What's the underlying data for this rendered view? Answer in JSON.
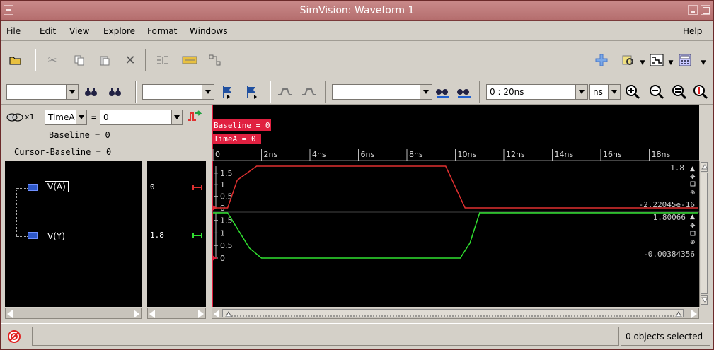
{
  "window": {
    "title": "SimVision: Waveform 1"
  },
  "menu": {
    "file": "File",
    "edit": "Edit",
    "view": "View",
    "explore": "Explore",
    "format": "Format",
    "windows": "Windows",
    "help": "Help"
  },
  "toolbar2": {
    "search_value": "",
    "signal_combo_value": "",
    "cursor_combo_value": "",
    "time_range": "0 : 20ns",
    "time_unit": "ns"
  },
  "cursor_header": {
    "cursor_name": "TimeA",
    "equals": "=",
    "cursor_value": "0",
    "zoom_label": "x1",
    "baseline_text": "Baseline = 0",
    "cursor_baseline_text": "Cursor-Baseline = 0"
  },
  "timeline": {
    "baseline_marker": "Baseline = 0",
    "timea_marker": "TimeA = 0",
    "ticks": [
      "0",
      "2ns",
      "4ns",
      "6ns",
      "8ns",
      "10ns",
      "12ns",
      "14ns",
      "16ns",
      "18ns"
    ]
  },
  "signals": [
    {
      "name": "V(A)",
      "value": "0",
      "color": "#e03030"
    },
    {
      "name": "V(Y)",
      "value": "1.8",
      "color": "#30e030"
    }
  ],
  "waveform_labels": {
    "a_ticks": [
      "1.5",
      "1",
      "0.5",
      "0"
    ],
    "y_ticks": [
      "1.5",
      "1",
      "0.5",
      "0"
    ],
    "a_max": "1.8",
    "a_min": "-2.22045e-16",
    "y_max": "1.80066",
    "y_min": "-0.00384356"
  },
  "chart_data": [
    {
      "type": "line",
      "series": [
        {
          "name": "V(A)",
          "x": [
            0,
            0.6,
            1.0,
            1.8,
            9.6,
            10.4,
            20
          ],
          "values": [
            0,
            0,
            1.2,
            1.8,
            1.8,
            0,
            0
          ]
        }
      ],
      "xlim": [
        0,
        20
      ],
      "ylim": [
        0,
        1.8
      ]
    },
    {
      "type": "line",
      "series": [
        {
          "name": "V(Y)",
          "x": [
            0,
            0.6,
            1.5,
            2.0,
            10.2,
            10.6,
            11.0,
            20
          ],
          "values": [
            1.8,
            1.8,
            0.4,
            0,
            0,
            0.6,
            1.8,
            1.8
          ]
        }
      ],
      "xlim": [
        0,
        20
      ],
      "ylim": [
        0,
        1.8
      ]
    }
  ],
  "status": {
    "selection": "0 objects selected"
  },
  "colors": {
    "accent_red": "#e02040",
    "wave_red": "#e03030",
    "wave_green": "#30e030"
  }
}
